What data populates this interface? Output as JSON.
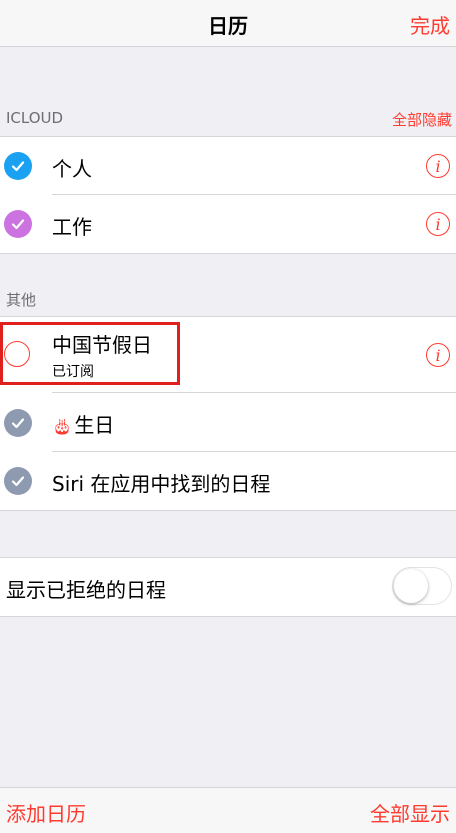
{
  "nav": {
    "title": "日历",
    "done_label": "完成"
  },
  "icloud": {
    "header": "ICLOUD",
    "action": "全部隐藏",
    "items": [
      {
        "label": "个人",
        "color": "#1ba1f2",
        "icon": "info-icon"
      },
      {
        "label": "工作",
        "color": "#cc73e1",
        "icon": "info-icon"
      }
    ]
  },
  "other": {
    "header": "其他",
    "items": [
      {
        "label": "中国节假日",
        "sublabel": "已订阅",
        "checked": false,
        "icon": "info-icon"
      },
      {
        "label": "生日",
        "prefix_icon": "birthday-icon",
        "color": "#8e9aaf"
      },
      {
        "label": "Siri 在应用中找到的日程",
        "color": "#8e9aaf"
      }
    ]
  },
  "declined": {
    "label": "显示已拒绝的日程",
    "toggle_on": false
  },
  "bottom": {
    "add_label": "添加日历",
    "show_all_label": "全部显示"
  },
  "colors": {
    "accent": "#ff3b30"
  }
}
